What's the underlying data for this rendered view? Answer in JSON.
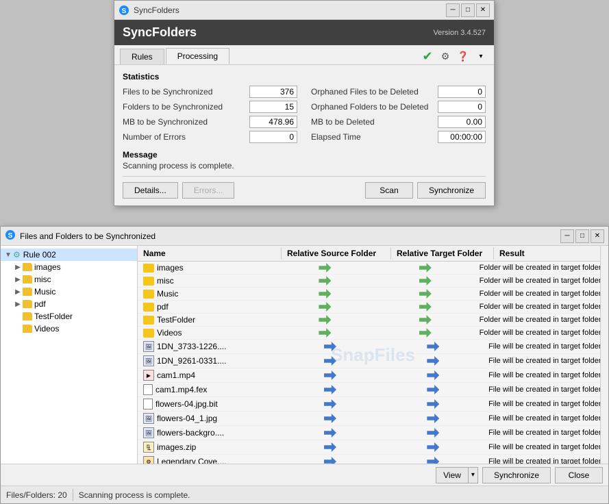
{
  "topWindow": {
    "title": "SyncFolders",
    "appTitle": "SyncFolders",
    "version": "Version 3.4.527",
    "tabs": [
      {
        "label": "Rules",
        "id": "rules"
      },
      {
        "label": "Processing",
        "id": "processing",
        "active": true
      }
    ],
    "stats": {
      "left": [
        {
          "label": "Files to be Synchronized",
          "value": "376"
        },
        {
          "label": "Folders to be Synchronized",
          "value": "15"
        },
        {
          "label": "MB to be Synchronized",
          "value": "478.96"
        },
        {
          "label": "Number of Errors",
          "value": "0"
        }
      ],
      "right": [
        {
          "label": "Orphaned Files to be Deleted",
          "value": "0"
        },
        {
          "label": "Orphaned Folders to be Deleted",
          "value": "0"
        },
        {
          "label": "MB to be Deleted",
          "value": "0.00"
        },
        {
          "label": "Elapsed Time",
          "value": "00:00:00"
        }
      ]
    },
    "message": {
      "label": "Message",
      "text": "Scanning process is complete."
    },
    "buttons": {
      "details": "Details...",
      "errors": "Errors...",
      "scan": "Scan",
      "synchronize": "Synchronize"
    }
  },
  "bottomWindow": {
    "title": "Files and Folders to be Synchronized",
    "treeItems": [
      {
        "label": "Rule 002",
        "level": 0,
        "expanded": true,
        "isRule": true
      },
      {
        "label": "images",
        "level": 1,
        "expanded": true
      },
      {
        "label": "misc",
        "level": 1,
        "expanded": false
      },
      {
        "label": "Music",
        "level": 1,
        "expanded": false
      },
      {
        "label": "pdf",
        "level": 1,
        "expanded": false
      },
      {
        "label": "TestFolder",
        "level": 1,
        "expanded": false
      },
      {
        "label": "Videos",
        "level": 1,
        "expanded": false
      }
    ],
    "tableHeaders": {
      "name": "Name",
      "srcFolder": "Relative Source Folder",
      "tgtFolder": "Relative Target Folder",
      "result": "Result"
    },
    "tableRows": [
      {
        "name": "images",
        "type": "folder",
        "result": "Folder will be created in target folder."
      },
      {
        "name": "misc",
        "type": "folder",
        "result": "Folder will be created in target folder."
      },
      {
        "name": "Music",
        "type": "folder",
        "result": "Folder will be created in target folder."
      },
      {
        "name": "pdf",
        "type": "folder",
        "result": "Folder will be created in target folder."
      },
      {
        "name": "TestFolder",
        "type": "folder",
        "result": "Folder will be created in target folder."
      },
      {
        "name": "Videos",
        "type": "folder",
        "result": "Folder will be created in target folder."
      },
      {
        "name": "1DN_3733-1226....",
        "type": "image",
        "result": "File will be created in target folder."
      },
      {
        "name": "1DN_9261-0331....",
        "type": "image",
        "result": "File will be created in target folder."
      },
      {
        "name": "cam1.mp4",
        "type": "video",
        "result": "File will be created in target folder."
      },
      {
        "name": "cam1.mp4.fex",
        "type": "file",
        "result": "File will be created in target folder."
      },
      {
        "name": "flowers-04.jpg.bit",
        "type": "file",
        "result": "File will be created in target folder."
      },
      {
        "name": "flowers-04_1.jpg",
        "type": "image",
        "result": "File will be created in target folder."
      },
      {
        "name": "flowers-backgro....",
        "type": "image",
        "result": "File will be created in target folder."
      },
      {
        "name": "images.zip",
        "type": "zip",
        "result": "File will be created in target folder."
      },
      {
        "name": "Legendary Cove....",
        "type": "setup",
        "result": "File will be created in target folder."
      }
    ],
    "watermark": "SnapFiles",
    "buttons": {
      "view": "View",
      "synchronize": "Synchronize",
      "close": "Close"
    },
    "statusBar": {
      "filesCount": "Files/Folders: 20",
      "message": "Scanning process is complete."
    }
  }
}
